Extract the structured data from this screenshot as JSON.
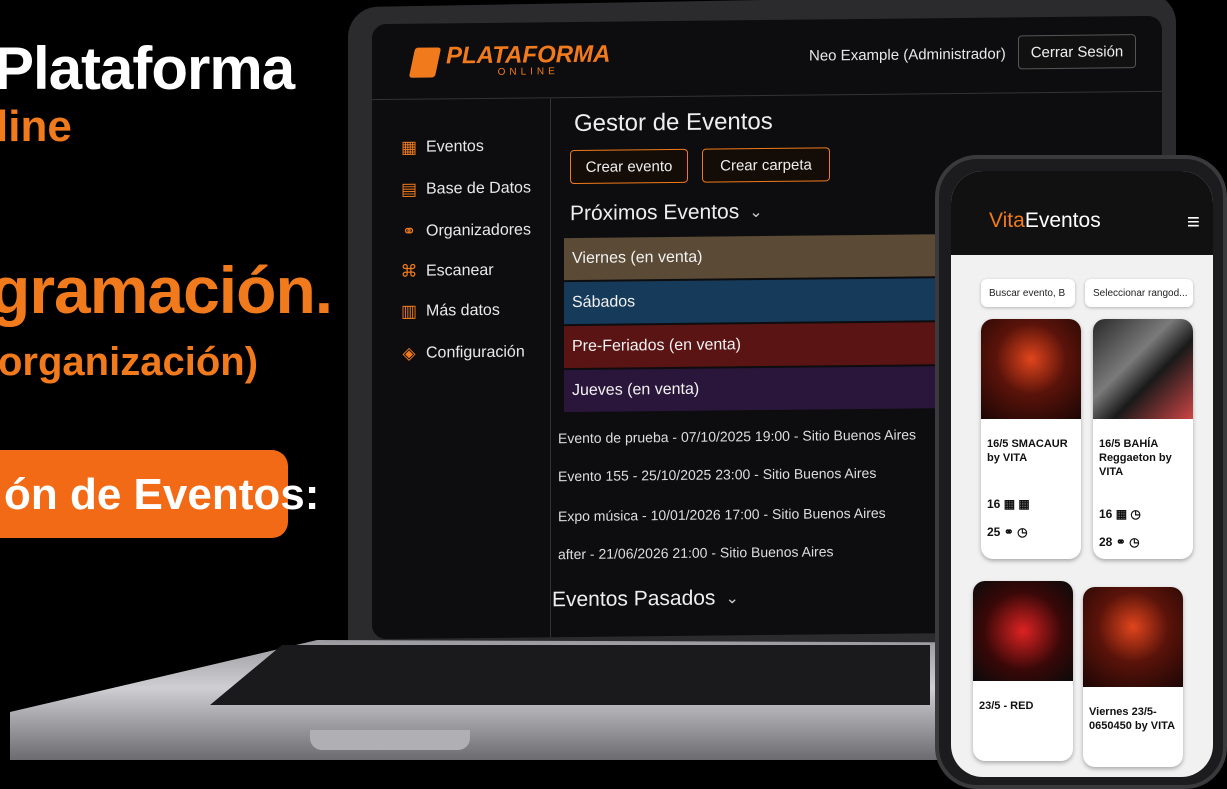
{
  "promo": {
    "line1": "Plataforma",
    "line2": "line",
    "line3": "gramación.",
    "line4": "organización)",
    "badge": "ón de Eventos:"
  },
  "app": {
    "logo": {
      "name": "PLATAFORMA",
      "sub": "ONLINE"
    },
    "user": "Neo Example (Administrador)",
    "logout": "Cerrar Sesión"
  },
  "sidebar": {
    "items": [
      {
        "label": "Eventos",
        "icon": "calendar-icon"
      },
      {
        "label": "Base de Datos",
        "icon": "database-icon"
      },
      {
        "label": "Organizadores",
        "icon": "people-icon"
      },
      {
        "label": "Escanear",
        "icon": "scan-icon"
      },
      {
        "label": "Más datos",
        "icon": "chart-icon"
      },
      {
        "label": "Configuración",
        "icon": "gear-icon"
      }
    ]
  },
  "main": {
    "title": "Gestor de Eventos",
    "create_event": "Crear evento",
    "create_folder": "Crear carpeta",
    "upcoming": "Próximos Eventos",
    "past": "Eventos Pasados",
    "categories": [
      {
        "label": "Viernes (en venta)",
        "color": "#5a4a36"
      },
      {
        "label": "Sábados",
        "color": "#163a5a"
      },
      {
        "label": "Pre-Feriados (en venta)",
        "color": "#5a1414"
      },
      {
        "label": "Jueves (en venta)",
        "color": "#2a163a"
      }
    ],
    "events": [
      "Evento de prueba - 07/10/2025 19:00 - Sitio Buenos Aires",
      "Evento 155 - 25/10/2025 23:00 - Sitio Buenos Aires",
      "Expo música - 10/01/2026 17:00 - Sitio Buenos Aires",
      "after - 21/06/2026 21:00 - Sitio Buenos Aires"
    ]
  },
  "phone": {
    "brand_a": "Vita",
    "brand_b": "Eventos",
    "search_placeholder": "Buscar evento, B",
    "range_select": "Seleccionar rangod...",
    "cards": [
      {
        "title": "16/5 SMACAUR by VITA",
        "stat1": "16",
        "stat2": "25"
      },
      {
        "title": "16/5 BAHÍA Reggaeton by VITA",
        "stat1": "16",
        "stat2": "28"
      },
      {
        "title": "23/5 - RED"
      },
      {
        "title": "Viernes 23/5-0650450 by VITA"
      }
    ]
  },
  "colors": {
    "accent": "#f07a1c"
  }
}
